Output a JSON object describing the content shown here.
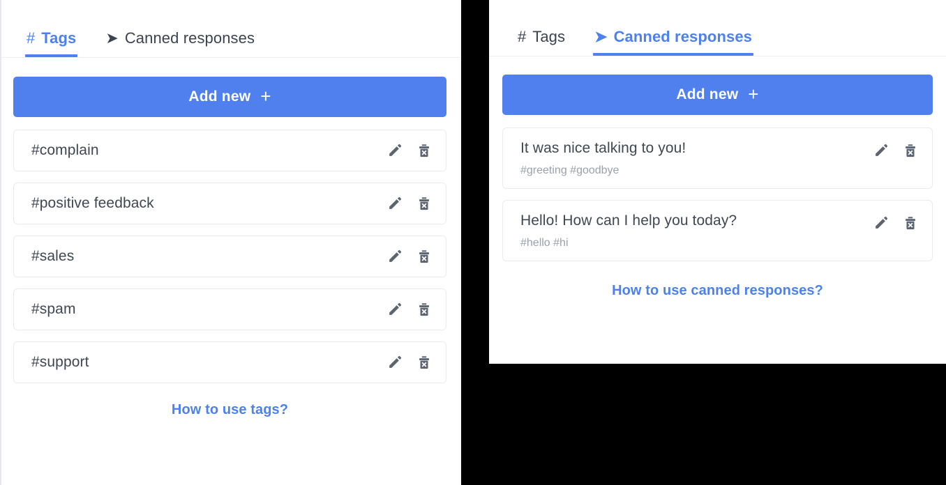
{
  "colors": {
    "accent": "#4d81ef",
    "button": "#5080ee",
    "text_primary": "#3f4753",
    "text_muted": "#9aa1ab",
    "border": "#e9ebef",
    "backdrop": "#000000"
  },
  "panels": {
    "tags_panel": {
      "tabs": [
        {
          "glyph": "#",
          "icon": "hash-icon",
          "label": "Tags",
          "active": true
        },
        {
          "glyph": "➤",
          "icon": "send-arrow-icon",
          "label": "Canned responses",
          "active": false
        }
      ],
      "add_button": {
        "label": "Add new",
        "plus": "+"
      },
      "rows": [
        {
          "title": "#complain"
        },
        {
          "title": "#positive feedback"
        },
        {
          "title": "#sales"
        },
        {
          "title": "#spam"
        },
        {
          "title": "#support"
        }
      ],
      "help_link": "How to use tags?"
    },
    "canned_panel": {
      "tabs": [
        {
          "glyph": "#",
          "icon": "hash-icon",
          "label": "Tags",
          "active": false
        },
        {
          "glyph": "➤",
          "icon": "send-arrow-icon",
          "label": "Canned responses",
          "active": true
        }
      ],
      "add_button": {
        "label": "Add new",
        "plus": "+"
      },
      "rows": [
        {
          "title": "It was nice talking to you!",
          "tags": "#greeting #goodbye"
        },
        {
          "title": "Hello! How can I help you today?",
          "tags": "#hello #hi"
        }
      ],
      "help_link": "How to use canned responses?"
    }
  },
  "icons": {
    "edit": "pencil-icon",
    "delete": "trash-x-icon"
  }
}
